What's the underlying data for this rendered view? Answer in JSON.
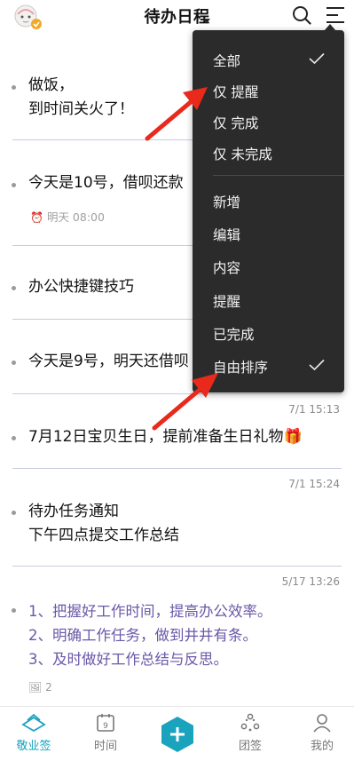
{
  "header": {
    "title": "待办日程",
    "avatar_icon": "avatar-cartoon-icon",
    "search_icon": "search-icon",
    "menu_icon": "menu-lines-icon"
  },
  "items": [
    {
      "lines": [
        "做饭，",
        "到时间关火了！"
      ]
    },
    {
      "lines": [
        "今天是10号，借呗还款"
      ],
      "reminder": "明天 08:00"
    },
    {
      "lines": [
        "办公快捷键技巧"
      ]
    },
    {
      "lines": [
        "今天是9号，明天还借呗"
      ]
    },
    {
      "lines": [
        "7月12日宝贝生日，提前准备生日礼物🎁"
      ],
      "timestamp": "7/1 15:13"
    },
    {
      "lines": [
        "待办任务通知",
        "下午四点提交工作总结"
      ],
      "timestamp": "7/1 15:24"
    },
    {
      "lines": [
        "1、把握好工作时间，提高办公效率。",
        "2、明确工作任务，做到井井有条。",
        "3、及时做好工作总结与反思。"
      ],
      "timestamp": "5/17 13:26",
      "attachments": "2"
    }
  ],
  "dropdown": {
    "items": [
      {
        "label": "全部",
        "checked": true
      },
      {
        "label": "仅 提醒",
        "checked": false
      },
      {
        "label": "仅 完成",
        "checked": false
      },
      {
        "label": "仅 未完成",
        "checked": false
      },
      {
        "label": "新增",
        "checked": false
      },
      {
        "label": "编辑",
        "checked": false
      },
      {
        "label": "内容",
        "checked": false
      },
      {
        "label": "提醒",
        "checked": false
      },
      {
        "label": "已完成",
        "checked": false
      },
      {
        "label": "自由排序",
        "checked": true
      }
    ]
  },
  "bottom_nav": {
    "items": [
      {
        "label": "敬业签",
        "icon": "note-stack-icon",
        "active": true
      },
      {
        "label": "时间",
        "icon": "calendar-icon",
        "calendar_day": "9",
        "active": false
      },
      {
        "label": "",
        "icon": "add-icon",
        "active": false
      },
      {
        "label": "团签",
        "icon": "team-icon",
        "active": false
      },
      {
        "label": "我的",
        "icon": "person-icon",
        "active": false
      }
    ]
  },
  "colors": {
    "accent": "#1aa3bd",
    "menu_bg": "#2b2b2b",
    "arrow_red": "#e8291c",
    "purple_text": "#6a58a8",
    "divider": "#c7cbe2"
  }
}
